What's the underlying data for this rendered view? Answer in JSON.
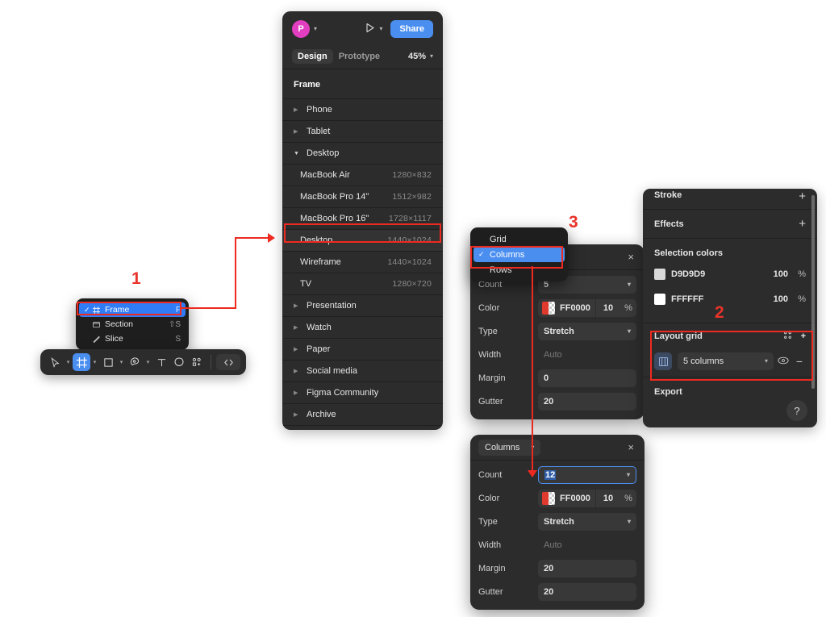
{
  "frame_panel": {
    "avatar_letter": "P",
    "share_label": "Share",
    "tabs": [
      {
        "label": "Design",
        "active": true
      },
      {
        "label": "Prototype",
        "active": false
      }
    ],
    "zoom": "45%",
    "section_title": "Frame",
    "groups": [
      {
        "label": "Phone",
        "expanded": false
      },
      {
        "label": "Tablet",
        "expanded": false
      },
      {
        "label": "Desktop",
        "expanded": true,
        "items": [
          {
            "label": "MacBook Air",
            "size": "1280×832",
            "selected": false
          },
          {
            "label": "MacBook Pro 14\"",
            "size": "1512×982",
            "selected": false
          },
          {
            "label": "MacBook Pro 16\"",
            "size": "1728×1117",
            "selected": false
          },
          {
            "label": "Desktop",
            "size": "1440×1024",
            "selected": true
          },
          {
            "label": "Wireframe",
            "size": "1440×1024",
            "selected": false
          },
          {
            "label": "TV",
            "size": "1280×720",
            "selected": false
          }
        ]
      },
      {
        "label": "Presentation",
        "expanded": false
      },
      {
        "label": "Watch",
        "expanded": false
      },
      {
        "label": "Paper",
        "expanded": false
      },
      {
        "label": "Social media",
        "expanded": false
      },
      {
        "label": "Figma Community",
        "expanded": false
      },
      {
        "label": "Archive",
        "expanded": false
      }
    ]
  },
  "context_menu": {
    "items": [
      {
        "label": "Frame",
        "shortcut": "F",
        "checked": true,
        "icon": "frame-icon"
      },
      {
        "label": "Section",
        "shortcut": "⇧S",
        "checked": false,
        "icon": "section-icon"
      },
      {
        "label": "Slice",
        "shortcut": "S",
        "checked": false,
        "icon": "slice-icon"
      }
    ]
  },
  "toolbar": {
    "items": [
      {
        "name": "move-tool",
        "icon": "cursor-icon",
        "active": false,
        "caret": true
      },
      {
        "name": "frame-tool",
        "icon": "frame-icon",
        "active": true,
        "caret": true
      },
      {
        "name": "shape-tool",
        "icon": "rectangle-icon",
        "active": false,
        "caret": true
      },
      {
        "name": "pen-tool",
        "icon": "pen-icon",
        "active": false,
        "caret": true
      },
      {
        "name": "text-tool",
        "icon": "text-icon",
        "active": false,
        "caret": false
      },
      {
        "name": "comment-tool",
        "icon": "comment-icon",
        "active": false,
        "caret": false
      },
      {
        "name": "actions-tool",
        "icon": "plugins-icon",
        "active": false,
        "caret": false
      }
    ],
    "code_label": "‹›"
  },
  "grid_type_menu": {
    "items": [
      {
        "label": "Grid",
        "checked": false
      },
      {
        "label": "Columns",
        "checked": true
      },
      {
        "label": "Rows",
        "checked": false
      }
    ]
  },
  "grid_panel_top": {
    "header_chip": "Columns",
    "close": "×",
    "rows": [
      {
        "label": "Count",
        "value": "5",
        "kind": "select"
      },
      {
        "label": "Color",
        "value": "FF0000",
        "opacity": "10",
        "unit": "%",
        "kind": "color"
      },
      {
        "label": "Type",
        "value": "Stretch",
        "kind": "select"
      },
      {
        "label": "Width",
        "value": "Auto",
        "kind": "placeholder"
      },
      {
        "label": "Margin",
        "value": "0",
        "kind": "text"
      },
      {
        "label": "Gutter",
        "value": "20",
        "kind": "text"
      }
    ]
  },
  "grid_panel_bottom": {
    "header_chip": "Columns",
    "close": "×",
    "rows": [
      {
        "label": "Count",
        "value": "12",
        "kind": "select",
        "focused": true
      },
      {
        "label": "Color",
        "value": "FF0000",
        "opacity": "10",
        "unit": "%",
        "kind": "color"
      },
      {
        "label": "Type",
        "value": "Stretch",
        "kind": "select"
      },
      {
        "label": "Width",
        "value": "Auto",
        "kind": "placeholder"
      },
      {
        "label": "Margin",
        "value": "20",
        "kind": "text"
      },
      {
        "label": "Gutter",
        "value": "20",
        "kind": "text"
      }
    ]
  },
  "right_panel": {
    "stroke_label": "Stroke",
    "effects_label": "Effects",
    "selection_colors_label": "Selection colors",
    "selection_colors": [
      {
        "hex": "D9D9D9",
        "swatch": "#d9d9d9",
        "opacity": "100",
        "unit": "%"
      },
      {
        "hex": "FFFFFF",
        "swatch": "#ffffff",
        "opacity": "100",
        "unit": "%"
      }
    ],
    "layout_grid_label": "Layout grid",
    "layout_grid_value": "5 columns",
    "export_label": "Export",
    "help_label": "?"
  },
  "annotations": {
    "numbers": [
      "1",
      "2",
      "3"
    ],
    "color": "#ee2a20"
  }
}
